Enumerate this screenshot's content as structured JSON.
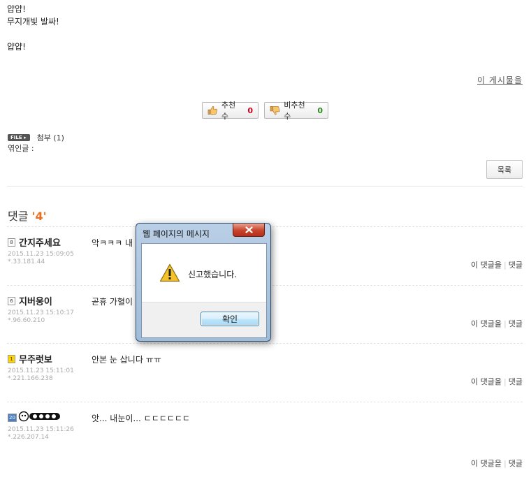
{
  "post": {
    "lines": [
      "얍얍!",
      "무지개빛 발싸!",
      "",
      "얍얍!"
    ],
    "board_link": "이 게시물을"
  },
  "votes": {
    "up_label": "추천 수",
    "up_count": "0",
    "down_label": "비추천 수",
    "down_count": "0",
    "up_color": "#d0021b",
    "down_color": "#2e8b20"
  },
  "attachment": {
    "badge": "FILE",
    "label": "첨부 (1)",
    "trackback": "엮인글 :"
  },
  "list_button": "목록",
  "comments": {
    "title": "댓글",
    "count": "'4'",
    "items": [
      {
        "level": "8",
        "nick": "간지주세요",
        "date": "2015.11.23 15:09:05",
        "ip": "*.33.181.44",
        "text": "악ㅋㅋㅋ 내",
        "action1": "이 댓글을",
        "action2": "댓글"
      },
      {
        "level": "6",
        "nick": "지버웅이",
        "date": "2015.11.23 15:10:17",
        "ip": "*.96.60.210",
        "text": "곧휴 가혈이",
        "action1": "이 댓글을",
        "action2": "댓글"
      },
      {
        "level": "1",
        "nick": "무주럿보",
        "date": "2015.11.23 15:11:01",
        "ip": "*.221.166.238",
        "text": "안본 눈 삽니다 ㅠㅠ",
        "action1": "이 댓글을",
        "action2": "댓글"
      },
      {
        "level": "20",
        "nick": "",
        "date": "2015.11.23 15:11:26",
        "ip": "*.226.207.14",
        "text": "앗... 내눈이... ㄷㄷㄷㄷㄷㄷ",
        "action1": "이 댓글을",
        "action2": "댓글"
      }
    ]
  },
  "dialog": {
    "title": "웹 페이지의 메시지",
    "message": "신고했습니다.",
    "ok": "확인",
    "icon": "warning-icon"
  },
  "colors": {
    "accent": "#ef6c1a"
  }
}
